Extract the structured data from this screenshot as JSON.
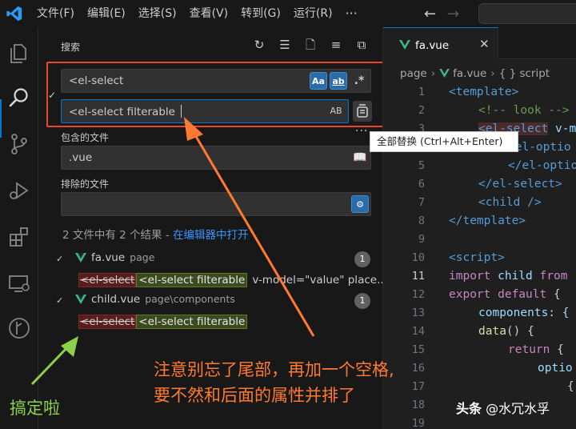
{
  "titlebar": {
    "menu": [
      "文件(F)",
      "编辑(E)",
      "选择(S)",
      "查看(V)",
      "转到(G)",
      "运行(R)"
    ],
    "more": "···"
  },
  "sidebar": {
    "title": "搜索",
    "search": {
      "value": "<el-select",
      "opt_case": "Aa",
      "opt_word": "ab",
      "opt_regex": ".*"
    },
    "replace": {
      "value": "<el-select filterable ",
      "opt_preserve_case": "AB"
    },
    "include": {
      "label": "包含的文件",
      "value": ".vue"
    },
    "exclude": {
      "label": "排除的文件",
      "value": ""
    },
    "results": {
      "summary": "2 文件中有 2 个结果 - ",
      "open_link": "在编辑器中打开",
      "files": [
        {
          "name": "fa.vue",
          "path": "page",
          "count": "1",
          "match_old": "<el-select",
          "match_new": "<el-select filterable",
          "match_rest": "v-model=\"value\" place..."
        },
        {
          "name": "child.vue",
          "path": "page\\components",
          "count": "1",
          "match_old": "<el-select",
          "match_new": "<el-select filterable",
          "match_rest": ""
        }
      ]
    },
    "tooltip": "全部替换 (Ctrl+Alt+Enter)"
  },
  "editor": {
    "tab": "fa.vue",
    "breadcrumbs": [
      "page",
      "fa.vue",
      "{ } script"
    ],
    "lines": [
      "1",
      "2",
      "3",
      "4",
      "5",
      "6",
      "7",
      "8",
      "9",
      "10",
      "11",
      "12",
      "13",
      "14",
      "15",
      "16",
      "17",
      "18",
      "19"
    ],
    "current_line": "11",
    "code": {
      "l1": "<template>",
      "l2": "<!-- look -->",
      "l3a": "<el-select",
      "l3b": " v-m",
      "l4": "<el-optio",
      "l5": "</el-optio",
      "l6": "</el-select>",
      "l7": "<child />",
      "l8": "</template>",
      "l10": "<script>",
      "l11a": "import",
      "l11b": " child ",
      "l11c": "from",
      "l12a": "export default",
      "l12b": " {",
      "l13": "components: {",
      "l14a": "data",
      "l14b": "() {",
      "l15a": "return",
      "l15b": " {",
      "l16": "optio",
      "l17": "{"
    }
  },
  "annotations": {
    "note_line1": "注意别忘了尾部，再加一个空格,",
    "note_line2": "要不然和后面的属性并排了",
    "done": "搞定啦",
    "watermark_brand": "头条",
    "watermark_user": " @水冗水孚"
  },
  "colors": {
    "accent": "#0078d4",
    "annotation_orange": "#ff7a2e",
    "annotation_green": "#8bd14a",
    "frame_red": "#e8452c",
    "vue_green": "#41b883"
  }
}
